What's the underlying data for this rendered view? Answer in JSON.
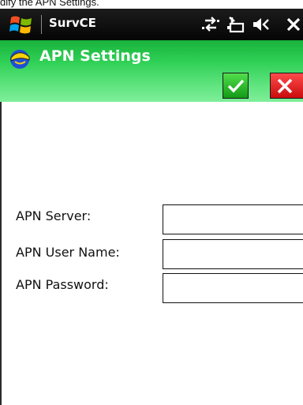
{
  "caption": "dify the APN Settings.",
  "taskbar": {
    "app_title": "SurvCE",
    "icons": [
      "windows-start-logo",
      "connectivity-icon",
      "battery-charging-icon",
      "speaker-muted-icon",
      "close-icon"
    ]
  },
  "header": {
    "title": "APN Settings",
    "icon": "helmet-icon",
    "ok_icon": "checkmark-icon",
    "cancel_icon": "x-icon"
  },
  "form": {
    "fields": [
      {
        "label": "APN Server:",
        "value": "",
        "placeholder": ""
      },
      {
        "label": "APN User Name:",
        "value": "",
        "placeholder": ""
      },
      {
        "label": "APN Password:",
        "value": "",
        "placeholder": ""
      }
    ]
  },
  "colors": {
    "taskbar": "#0d0d0d",
    "header_green": "#2fd056",
    "ok_green": "#2dbd2b",
    "cancel_red": "#e62121"
  }
}
